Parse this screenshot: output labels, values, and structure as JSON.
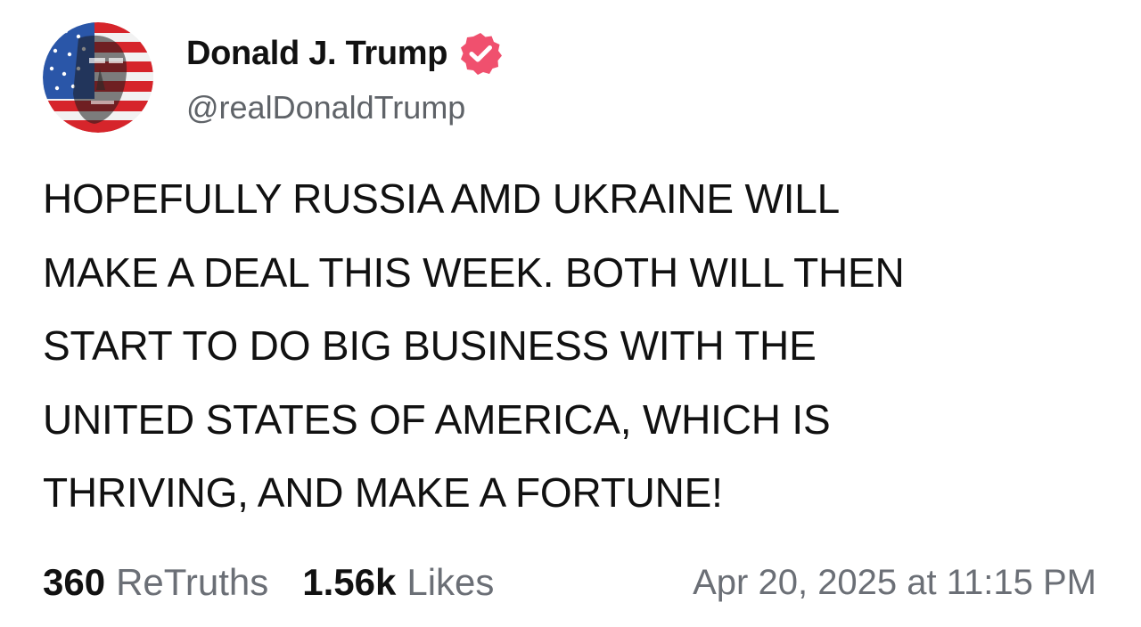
{
  "author": {
    "display_name": "Donald J. Trump",
    "handle": "@realDonaldTrump",
    "verified": true,
    "avatar_icon": "american-flag-portrait-avatar",
    "verified_icon": "verified-badge-icon"
  },
  "post": {
    "text": "HOPEFULLY RUSSIA AMD UKRAINE WILL\nMAKE A DEAL THIS WEEK. BOTH WILL THEN\nSTART TO DO BIG BUSINESS WITH THE\nUNITED STATES OF AMERICA, WHICH IS\nTHRIVING, AND MAKE A FORTUNE!"
  },
  "stats": {
    "retruths_count": "360",
    "retruths_label": "ReTruths",
    "likes_count": "1.56k",
    "likes_label": "Likes",
    "timestamp": "Apr 20, 2025 at 11:15 PM"
  },
  "colors": {
    "text": "#111111",
    "secondary_text": "#6b6f76",
    "verified_badge": "#f0506e",
    "background": "#ffffff"
  }
}
